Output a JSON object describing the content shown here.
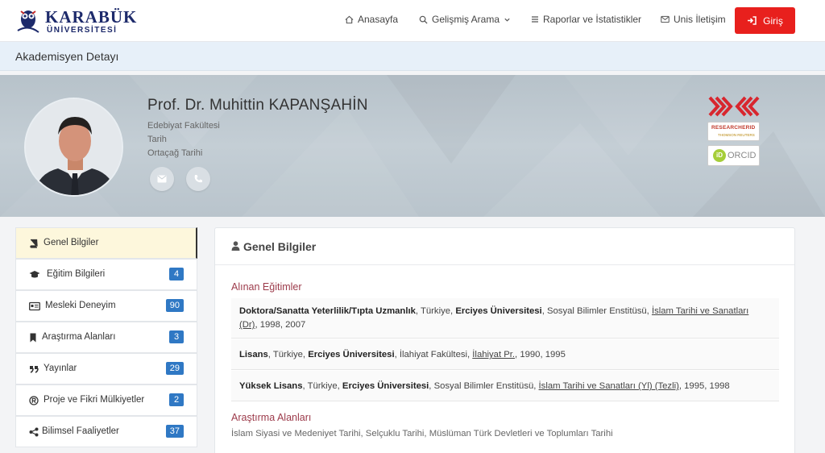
{
  "header": {
    "logo_line1": "KARABÜK",
    "logo_line2": "ÜNİVERSİTESİ",
    "nav": [
      {
        "label": "Anasayfa",
        "icon": "home-icon"
      },
      {
        "label": "Gelişmiş Arama",
        "icon": "search-icon"
      },
      {
        "label": "Raporlar ve İstatistikler",
        "icon": "list-icon"
      },
      {
        "label": "Unis İletişim",
        "icon": "envelope-icon"
      }
    ],
    "login_label": "Giriş"
  },
  "page_title": "Akademisyen Detayı",
  "profile": {
    "name": "Prof. Dr. Muhittin KAPANŞAHİN",
    "faculty": "Edebiyat Fakültesi",
    "department": "Tarih",
    "division": "Ortaçağ Tarihi",
    "badges": {
      "yok": "YÖK",
      "researcherid": "RESEARCHERID",
      "researcherid_sub": "THOMSON REUTERS",
      "orcid": "ORCID",
      "orcid_prefix": "iD"
    }
  },
  "sidebar": {
    "items": [
      {
        "label": "Genel Bilgiler",
        "icon": "book-icon",
        "count": null,
        "active": true
      },
      {
        "label": "Eğitim Bilgileri",
        "icon": "graduation-cap-icon",
        "count": "4"
      },
      {
        "label": "Mesleki Deneyim",
        "icon": "id-card-icon",
        "count": "90"
      },
      {
        "label": "Araştırma Alanları",
        "icon": "bookmark-icon",
        "count": "3"
      },
      {
        "label": "Yayınlar",
        "icon": "quote-icon",
        "count": "29"
      },
      {
        "label": "Proje ve Fikri Mülkiyetler",
        "icon": "registered-icon",
        "count": "2"
      },
      {
        "label": "Bilimsel Faaliyetler",
        "icon": "share-icon",
        "count": "37"
      }
    ]
  },
  "main": {
    "title": "Genel Bilgiler",
    "education_title": "Alınan Eğitimler",
    "education": [
      {
        "degree": "Doktora/Sanatta Yeterlilik/Tıpta Uzmanlık",
        "country": "Türkiye",
        "university": "Erciyes Üniversitesi",
        "institute": "Sosyal Bilimler Enstitüsü",
        "program_line1": "İslam Tarihi ve Sanatları",
        "program_line2": "(Dr)",
        "years": ", 1998, 2007"
      },
      {
        "degree": "Lisans",
        "country": "Türkiye",
        "university": "Erciyes Üniversitesi",
        "institute": "İlahiyat Fakültesi",
        "program": "İlahiyat Pr.",
        "years": ", 1990, 1995"
      },
      {
        "degree": "Yüksek Lisans",
        "country": "Türkiye",
        "university": "Erciyes Üniversitesi",
        "institute": "Sosyal Bilimler Enstitüsü",
        "program": "İslam Tarihi ve Sanatları (Yl) (Tezli)",
        "years": ", 1995, 1998"
      }
    ],
    "research_title": "Araştırma Alanları",
    "research_areas": "İslam Siyasi ve Medeniyet Tarihi, Selçuklu Tarihi, Müslüman Türk Devletleri ve Toplumları Tarihi"
  },
  "colors": {
    "accent_red": "#e8201d",
    "badge_blue": "#2f78c4",
    "section_title": "#9c3a4a",
    "active_item_bg": "#fdf7dc"
  }
}
